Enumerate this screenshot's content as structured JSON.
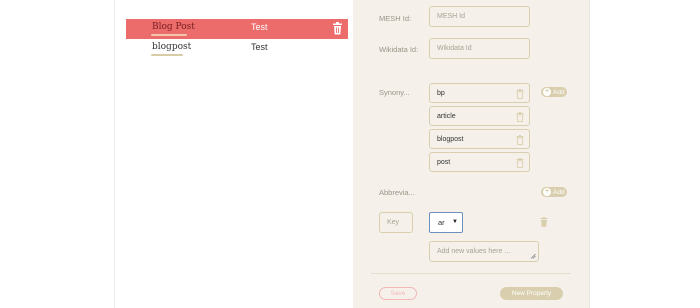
{
  "list": {
    "rows": [
      {
        "term": "Blog Post",
        "value": "Test",
        "selected": true
      },
      {
        "term": "blogpost",
        "value": "Test",
        "selected": false
      }
    ]
  },
  "form": {
    "mesh": {
      "label": "MESH Id:",
      "placeholder": "MESH Id"
    },
    "wikidata": {
      "label": "Wikidata Id:",
      "placeholder": "Wikidata Id"
    },
    "synonyms": {
      "label": "Synony...",
      "add_label": "Add",
      "items": [
        "bp",
        "article",
        "blogpost",
        "post"
      ]
    },
    "abbreviations": {
      "label": "Abbrevia...",
      "add_label": "Add"
    },
    "property": {
      "key_placeholder": "Key",
      "language_selected": "ar",
      "values_placeholder": "Add new values here ..."
    },
    "actions": {
      "save_label": "Save",
      "new_property_label": "New Property"
    }
  },
  "colors": {
    "selected_row": "#ec6b6b",
    "accent_tan": "#d9cfae",
    "panel_bg": "#f5f1ea",
    "save_outline": "#f0b8b8",
    "select_border": "#6b8fc0"
  },
  "icons": {
    "row_delete": "trash-icon",
    "synonym_delete": "trash-icon",
    "add": "plus-circle-icon",
    "select_caret": "caret-down-icon"
  }
}
